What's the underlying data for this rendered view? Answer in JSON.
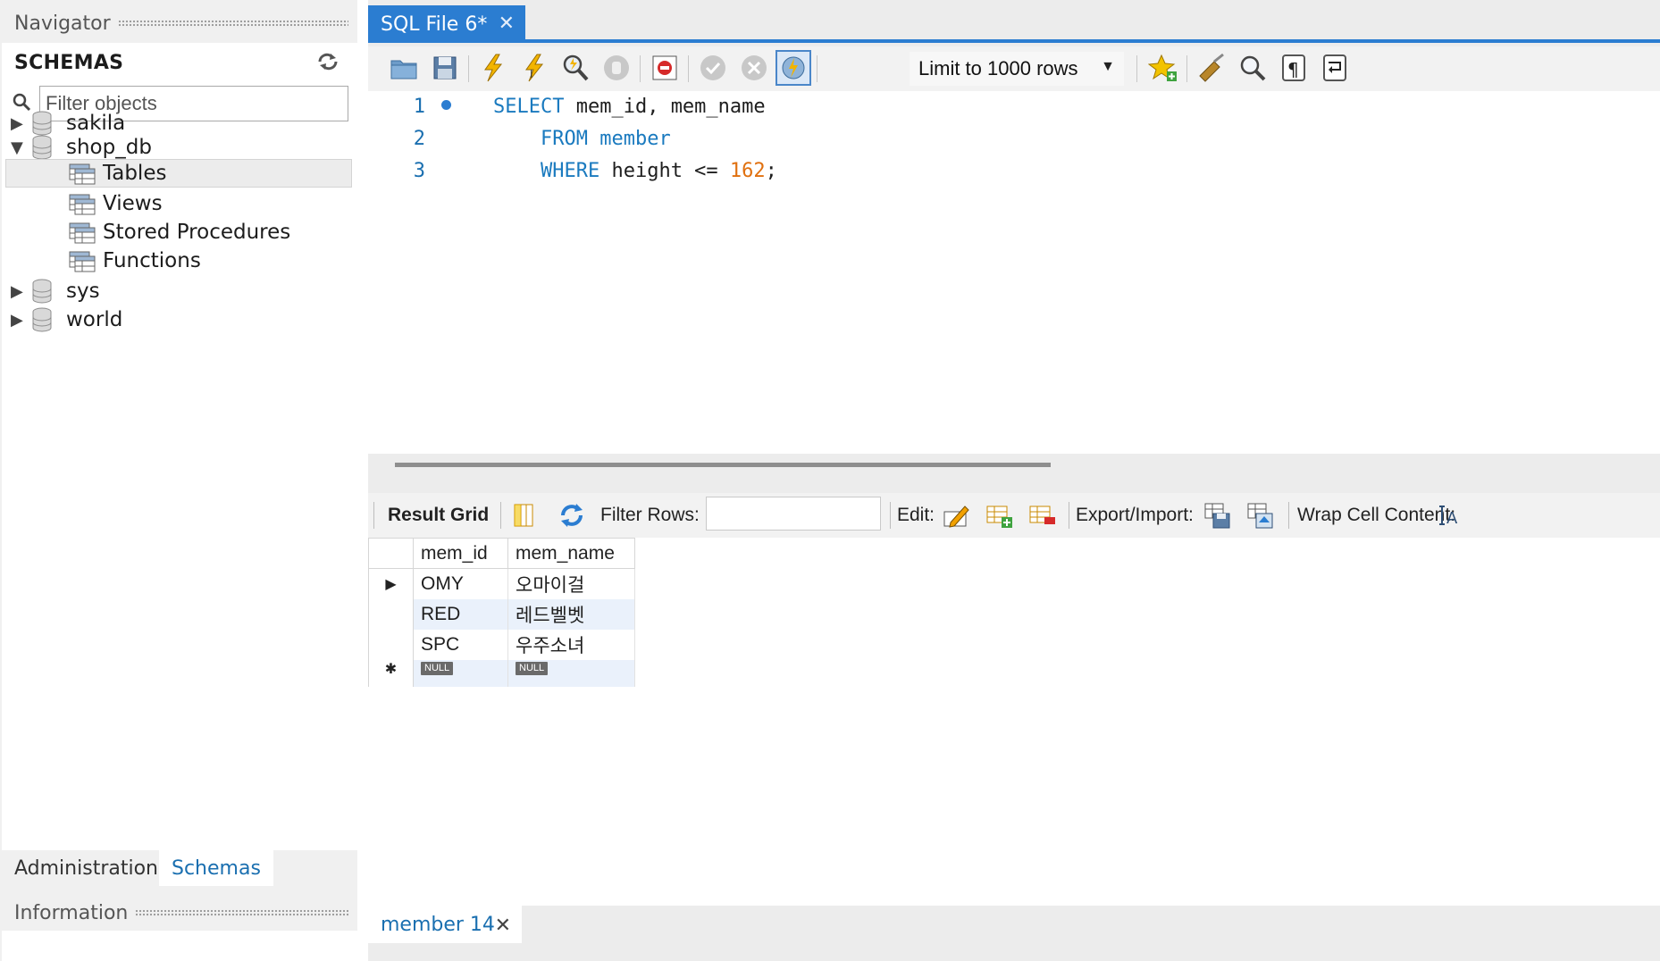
{
  "navigator": {
    "title": "Navigator",
    "schemas_header": "SCHEMAS",
    "filter_placeholder": "Filter objects",
    "tree": {
      "sakila": "sakila",
      "shop_db": "shop_db",
      "tables": "Tables",
      "views": "Views",
      "stored_procedures": "Stored Procedures",
      "functions": "Functions",
      "sys": "sys",
      "world": "world"
    },
    "tabs": {
      "administration": "Administration",
      "schemas": "Schemas"
    },
    "information_title": "Information"
  },
  "editor_tab": {
    "label": "SQL File 6*",
    "close": "✕"
  },
  "toolbar": {
    "limit_label": "Limit to 1000 rows",
    "icons": [
      "open-file-icon",
      "save-icon",
      "execute-icon",
      "execute-current-icon",
      "explain-icon",
      "stop-icon",
      "toggle-error-icon",
      "commit-icon",
      "rollback-icon",
      "autocommit-icon",
      "dropdown-arrow-icon",
      "add-snippet-icon",
      "beautify-icon",
      "find-icon",
      "invisible-chars-icon",
      "wrap-lines-icon"
    ]
  },
  "sql": {
    "line_numbers": [
      "1",
      "2",
      "3"
    ],
    "line1": {
      "kw": "SELECT",
      "rest": " mem_id, mem_name"
    },
    "line2": {
      "kw": "FROM",
      "rest": "member",
      "indent": "    "
    },
    "line3": {
      "kw": "WHERE",
      "rest": " height <= ",
      "num": "162",
      "end": ";",
      "indent": "    "
    }
  },
  "result_toolbar": {
    "result_grid": "Result Grid",
    "filter_rows": "Filter Rows:",
    "edit": "Edit:",
    "export_import": "Export/Import:",
    "wrap_cell": "Wrap Cell Content:"
  },
  "grid": {
    "columns": [
      "mem_id",
      "mem_name"
    ],
    "rows": [
      [
        "OMY",
        "오마이걸"
      ],
      [
        "RED",
        "레드벨벳"
      ],
      [
        "SPC",
        "우주소녀"
      ]
    ],
    "null_label": "NULL",
    "current_row_marker": "▶",
    "new_row_marker": "✱"
  },
  "result_tab": {
    "label": "member 14",
    "close": "✕"
  },
  "colors": {
    "accent": "#2b7dd1",
    "keyword": "#1a7abf",
    "number": "#e0700f"
  }
}
